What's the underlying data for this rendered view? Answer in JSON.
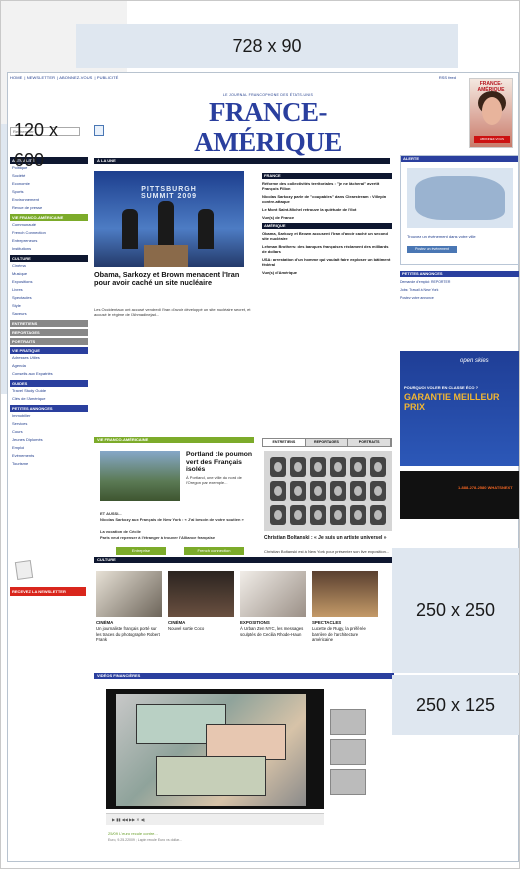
{
  "ads": {
    "top": "728 x 90",
    "left_line1": "120 x",
    "left_line2": "600",
    "right1": "250 x 250",
    "right2": "250 x 125"
  },
  "site": {
    "topnav": [
      "HOME",
      "NEWSLETTER",
      "ABONNEZ-VOUS",
      "PUBLICITÉ"
    ],
    "rss": "RSS feed",
    "logo_small": "LE JOURNAL FRANCOPHONE DES ÉTATS-UNIS",
    "logo": "FRANCE-AMÉRIQUE",
    "date": "VENDREDI 25 SEPTEMBRE 2009",
    "search_placeholder": "Rechercher...",
    "magazine": {
      "title": "FRANCE-AMÉRIQUE",
      "button": "ABONNEZ-VOUS"
    }
  },
  "leftnav": {
    "sections": [
      {
        "head": "ACTUALITÉ",
        "style": "dark",
        "items": [
          "Politique",
          "Société",
          "Economie",
          "Sports",
          "Environnement",
          "Revue de presse"
        ]
      },
      {
        "head": "VIE FRANCO-AMÉRICAINE",
        "style": "green",
        "items": [
          "Communauté",
          "French Connection",
          "Entrepreneurs",
          "Institutions"
        ]
      },
      {
        "head": "CULTURE",
        "style": "dark",
        "items": [
          "Cinéma",
          "Musique",
          "Expositions",
          "Livres",
          "Spectacles",
          "Style",
          "Saveurs"
        ]
      },
      {
        "head": "ENTRETIENS",
        "style": "gray",
        "items": []
      },
      {
        "head": "REPORTAGES",
        "style": "gray",
        "items": []
      },
      {
        "head": "PORTRAITS",
        "style": "gray",
        "items": []
      },
      {
        "head": "VIE PRATIQUE",
        "style": "blue",
        "items": [
          "Adresses Utiles",
          "Agenda",
          "Conseils aux Expatriés"
        ]
      },
      {
        "head": "GUIDES",
        "style": "blue",
        "items": [
          "Travel Study Guide",
          "Clés de l'Amérique"
        ]
      },
      {
        "head": "PETITES ANNONCES",
        "style": "blue",
        "items": [
          "Immobilier",
          "Services",
          "Cours",
          "Jeunes Diplomés",
          "Emploi",
          "Evènements",
          "Tourisme"
        ]
      }
    ],
    "newsletter": "RECEVEZ LA NEWSLETTER"
  },
  "main": {
    "section": "À LA UNE",
    "photo_sign": "PITTSBURGH SUMMIT 2009",
    "headline": "Obama, Sarkozy et Brown menacent l'Iran pour avoir caché un site nucléaire",
    "body": "Les Occidentaux ont accusé vendredi l'Iran d'avoir développé un site nucléaire secret, et accusé le régime de l'Ahmadinejad...",
    "france_head": "FRANCE",
    "france_links": [
      "Réforme des collectivités territoriales : \"je ne lâcherai\" avertit François Fillon",
      "Nicolas Sarkozy parle de \"coupables\" dans Clearstream : Villepin contre-attaque",
      "Le Mont Saint-Michel retrouve la quiétude de l'îlot",
      "Vue(s) de France"
    ],
    "amerique_head": "AMÉRIQUE",
    "amerique_links": [
      "Obama, Sarkozy et Brown accusent l'Iran d'avoir caché un second site nucléaire",
      "Lehman Brothers: des banques françaises réclament des milliards de dollars",
      "USA: arrestation d'un homme qui voulait faire exploser un bâtiment fédéral",
      "Vue(s) d'Amérique"
    ]
  },
  "vfa": {
    "bar": "VIE FRANCO-AMÉRICAINE",
    "title": "Portland :le poumon vert des Français isolés",
    "body": "À Portland, une ville du nord de l'Oregon par exemple...",
    "more": "ET AUSSI...",
    "links": [
      "Nicolas Sarkozy aux Français de New York : « J'ai besoin de votre soutien »",
      "La vocation de Cécile",
      "Paris veut repenser à l'étranger à trouver l'Alliance française"
    ],
    "btn1": "Entreprise",
    "btn2": "French connection"
  },
  "interviews": {
    "tabs": [
      "ENTRETIENS",
      "REPORTAGES",
      "PORTRAITS"
    ],
    "title": "Christian Boltanski : « Je suis un artiste universel »",
    "body": "Christian Boltanski est à New York pour présenter son live exposition..."
  },
  "alert": {
    "head": "ALERTE",
    "button": "Postez un événement",
    "text": "Trouvez un événement dans votre ville"
  },
  "petites": {
    "head": "PETITES ANNONCES",
    "links": [
      "Demande d'emploi: REPORTER",
      "Jobs: Travail à New York",
      "Postez votre annonce"
    ]
  },
  "openskies": {
    "brand": "open skies",
    "t1": "POURQUOI VOLER EN CLASSE ÉCO ?",
    "t2": "GARANTIE MEILLEUR PRIX"
  },
  "phonead": {
    "text": "1-888-278-2580 WHATSNEXT"
  },
  "culture": {
    "bar": "CULTURE",
    "items": [
      {
        "h": "CINÉMA",
        "t": "Un journaliste français porté sur les traces du photographe Robert Frank"
      },
      {
        "h": "CINÉMA",
        "t": "Nouvel sortie Coco"
      },
      {
        "h": "EXPOSITIONS",
        "t": "À Urban Zen NYC, les messages sculptés de Cecilia Rhode-Haun"
      },
      {
        "h": "SPECTACLES",
        "t": "Lucette de Rugy, la préférée barrière de l'architecture américaine"
      }
    ]
  },
  "video": {
    "bar": "VIDÉOS FINANCIÈRES",
    "caption": "25/09 L'euro recule contre...",
    "caption2": "Euro, 9.25.22009 ; Lapin recule Euro vs dollar..."
  }
}
